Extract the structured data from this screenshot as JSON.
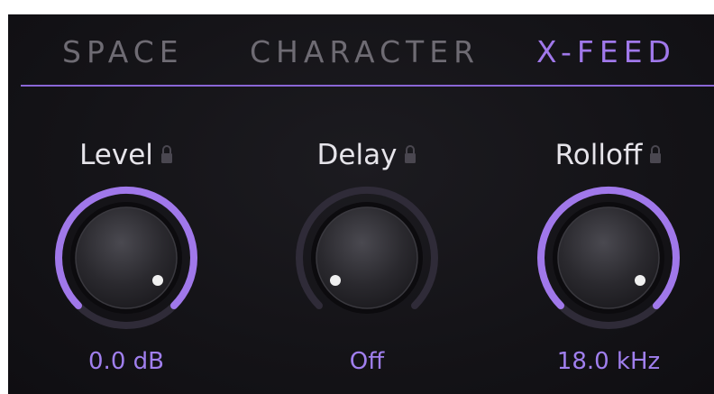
{
  "tabs": [
    {
      "label": "SPACE",
      "active": false
    },
    {
      "label": "CHARACTER",
      "active": false
    },
    {
      "label": "X-FEED",
      "active": true
    }
  ],
  "knobs": [
    {
      "title": "Level",
      "value": "0.0 dB",
      "lock_icon": "lock-icon"
    },
    {
      "title": "Delay",
      "value": "Off",
      "lock_icon": "lock-icon"
    },
    {
      "title": "Rolloff",
      "value": "18.0 kHz",
      "lock_icon": "lock-icon"
    }
  ],
  "colors": {
    "accent": "#a078ea",
    "value_text": "#a07fee",
    "inactive_tab": "#6e6b73",
    "ring_track": "#2f2b38",
    "background": "#141317"
  }
}
